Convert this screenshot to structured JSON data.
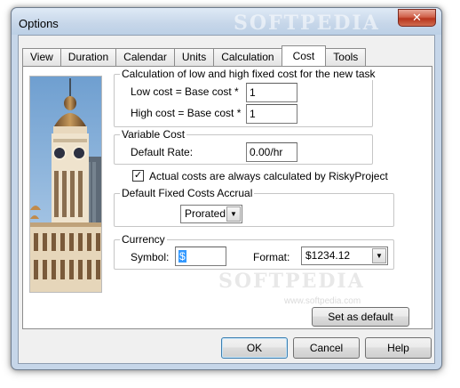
{
  "window": {
    "title": "Options",
    "watermark": "SOFTPEDIA",
    "close_glyph": "✕"
  },
  "tabs": [
    {
      "label": "View",
      "active": false
    },
    {
      "label": "Duration",
      "active": false
    },
    {
      "label": "Calendar",
      "active": false
    },
    {
      "label": "Units",
      "active": false
    },
    {
      "label": "Calculation",
      "active": false
    },
    {
      "label": "Cost",
      "active": true
    },
    {
      "label": "Tools",
      "active": false
    }
  ],
  "fixed_cost": {
    "group_title": "Calculation of low and high fixed cost for the new task",
    "low_label": "Low cost = Base cost *",
    "low_value": "1",
    "high_label": "High cost = Base cost *",
    "high_value": "1"
  },
  "variable_cost": {
    "group_title": "Variable Cost",
    "rate_label": "Default Rate:",
    "rate_value": "0.00/hr"
  },
  "actual_costs": {
    "label": "Actual costs are always calculated by RiskyProject",
    "checked": true,
    "check_glyph": "✓"
  },
  "accrual": {
    "group_title": "Default Fixed Costs Accrual",
    "selected": "Prorated"
  },
  "currency": {
    "group_title": "Currency",
    "symbol_label": "Symbol:",
    "symbol_value": "$",
    "format_label": "Format:",
    "format_selected": "$1234.12"
  },
  "watermark_panel": {
    "text": "SOFTPEDIA",
    "url": "www.softpedia.com"
  },
  "buttons": {
    "set_default": "Set as default",
    "ok": "OK",
    "cancel": "Cancel",
    "help": "Help"
  },
  "icons": {
    "dropdown": "chevron-down-icon",
    "close": "close-icon",
    "check": "checkmark-icon"
  }
}
